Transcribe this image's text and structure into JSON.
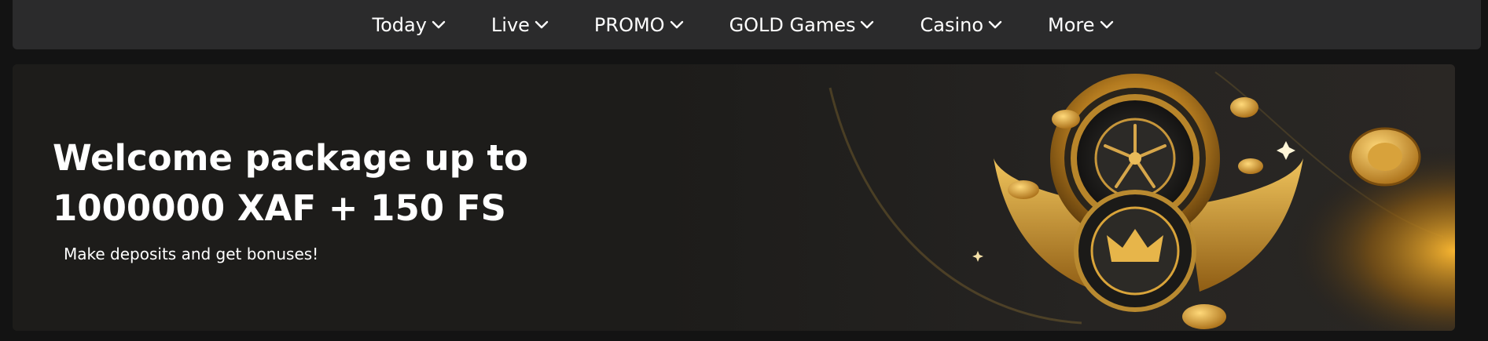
{
  "nav": {
    "items": [
      {
        "label": "Today"
      },
      {
        "label": "Live"
      },
      {
        "label": "PROMO"
      },
      {
        "label": "GOLD Games"
      },
      {
        "label": "Casino"
      },
      {
        "label": "More"
      }
    ],
    "chevron_icon": "chevron-down-icon"
  },
  "banner": {
    "title": "Welcome package up to 1000000 XAF + 150 FS",
    "subtitle": "Make deposits and get bonuses!",
    "art": "roulette-wheel-with-crown-chip-and-golden-wings",
    "colors": {
      "accent": "#d9a43a",
      "background": "#1d1c1a"
    }
  }
}
